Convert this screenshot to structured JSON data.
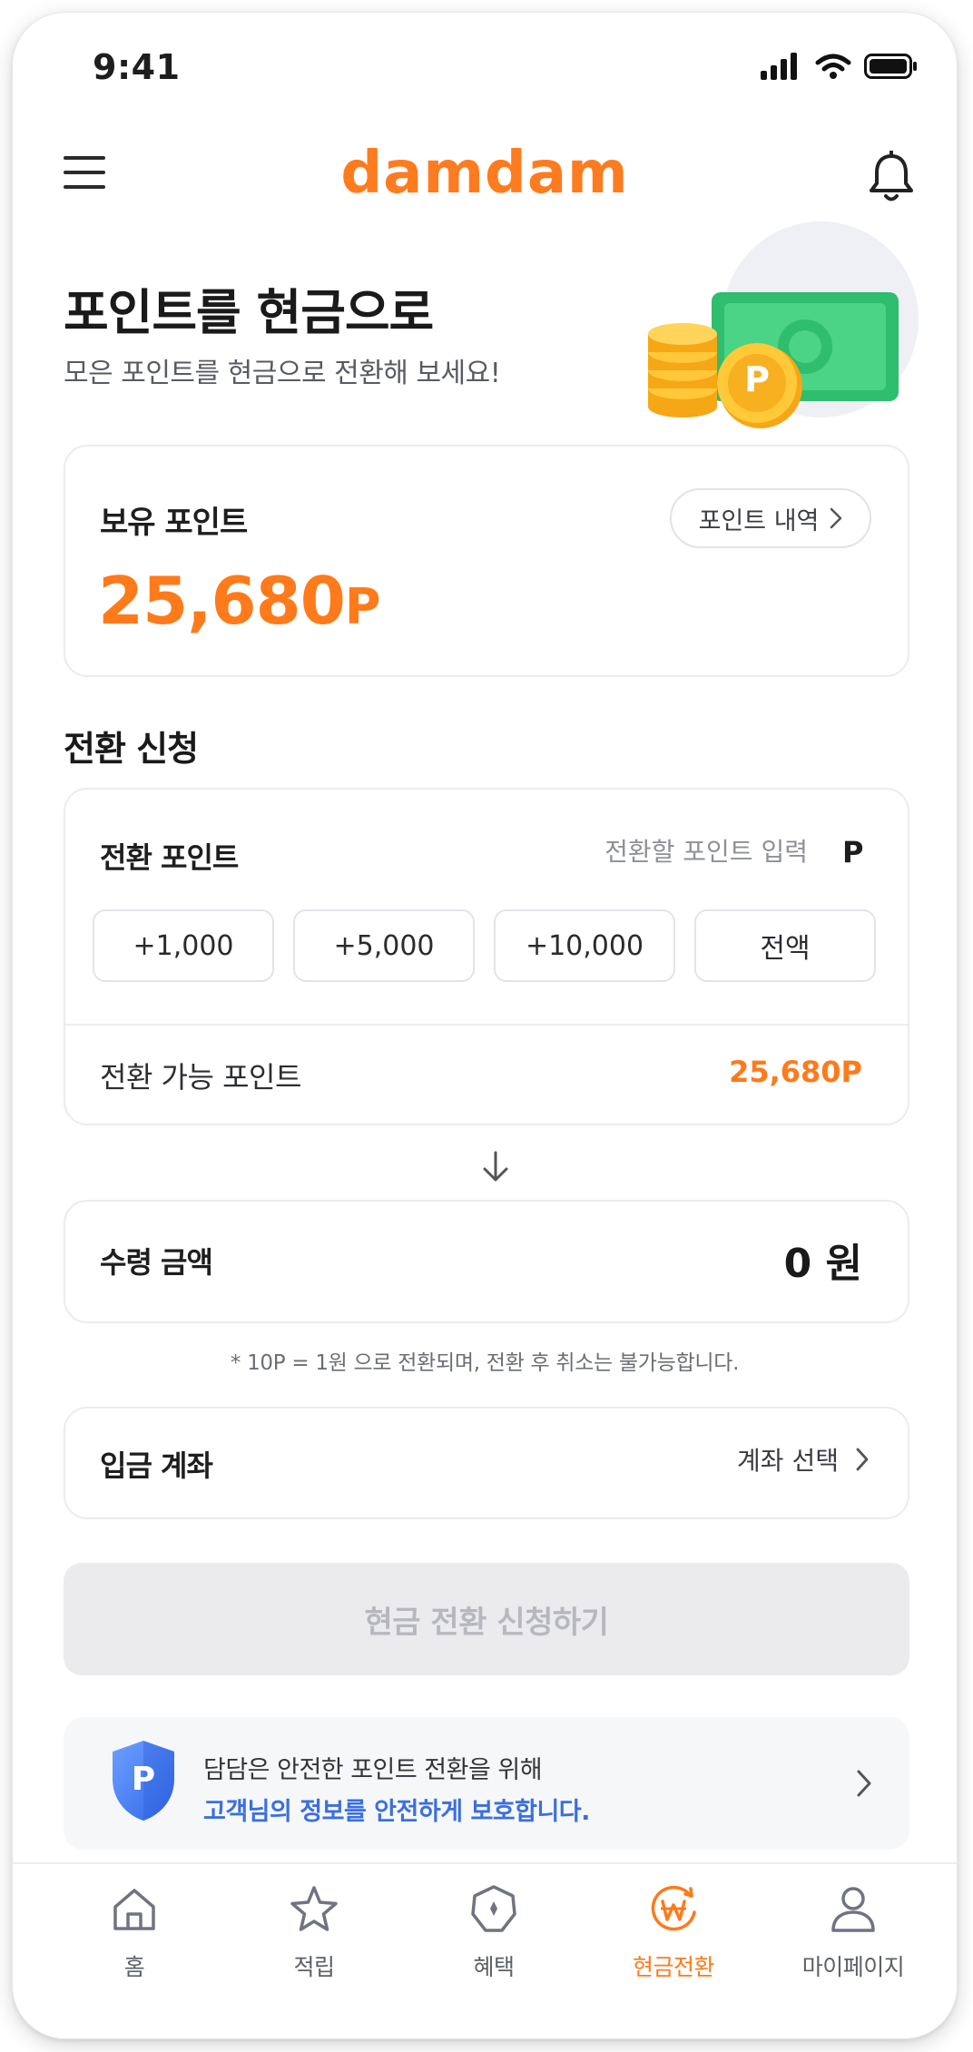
{
  "status_bar": {
    "time": "9:41"
  },
  "header": {
    "logo": "damdam"
  },
  "hero": {
    "title": "포인트를 현금으로",
    "subtitle": "모은 포인트를 현금으로 전환해 보세요!",
    "coin_symbol": "P"
  },
  "balance": {
    "label": "보유 포인트",
    "amount": "25,680",
    "unit": "P",
    "history_button": "포인트 내역"
  },
  "conversion": {
    "section_title": "전환 신청",
    "points_label": "전환 포인트",
    "input_placeholder": "전환할 포인트 입력",
    "input_unit": "P",
    "quick_buttons": [
      "+1,000",
      "+5,000",
      "+10,000",
      "전액"
    ],
    "available_label": "전환 가능 포인트",
    "available_value": "25,680P"
  },
  "receive": {
    "label": "수령 금액",
    "value": "0 원"
  },
  "notice": "* 10P = 1원 으로 전환되며, 전환 후 취소는 불가능합니다.",
  "account": {
    "label": "입금 계좌",
    "select_label": "계좌 선택"
  },
  "submit_button": "현금 전환 신청하기",
  "security": {
    "line1": "담담은 안전한 포인트 전환을 위해",
    "line2": "고객님의 정보를 안전하게 보호합니다.",
    "badge_letter": "P"
  },
  "tabs": [
    {
      "label": "홈",
      "icon": "home-icon",
      "active": false
    },
    {
      "label": "적립",
      "icon": "star-icon",
      "active": false
    },
    {
      "label": "혜택",
      "icon": "benefit-icon",
      "active": false
    },
    {
      "label": "현금전환",
      "icon": "won-exchange-icon",
      "active": true
    },
    {
      "label": "마이페이지",
      "icon": "person-icon",
      "active": false
    }
  ],
  "colors": {
    "accent": "#ff7a1a",
    "link": "#3b6fe0",
    "disabled": "#ebebee"
  }
}
